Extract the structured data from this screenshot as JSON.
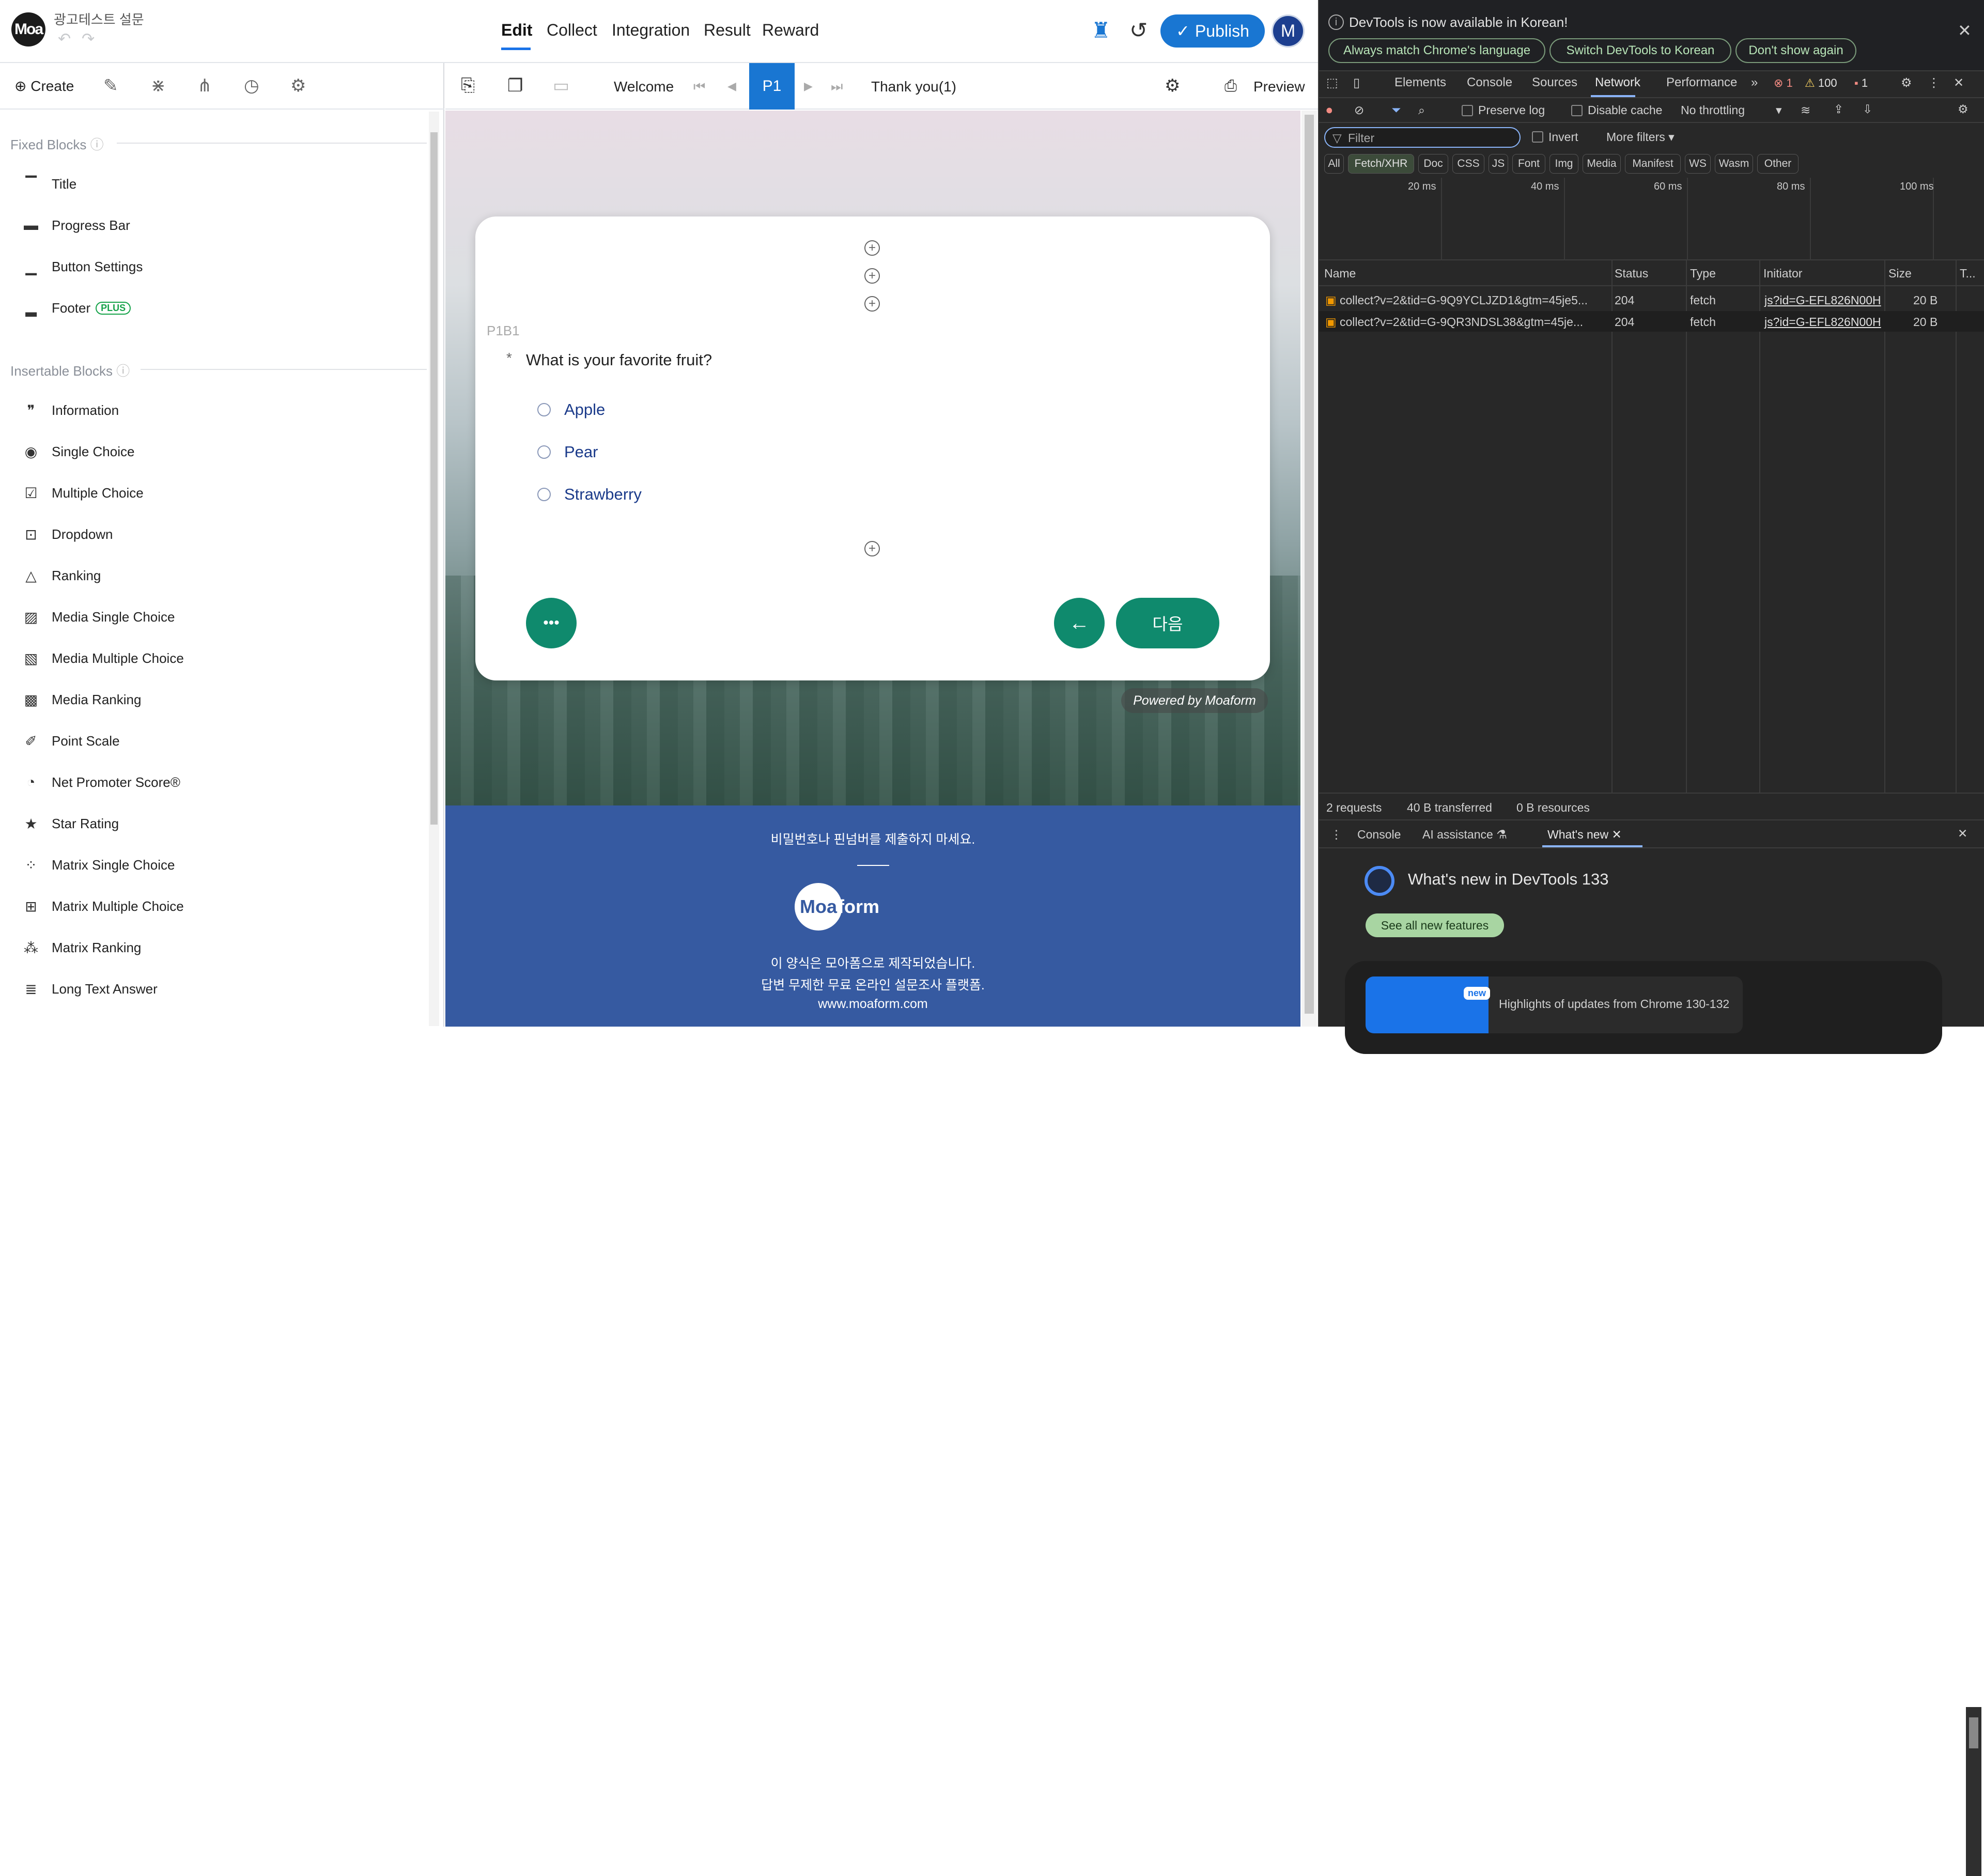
{
  "header": {
    "logo_text": "Moa",
    "form_title": "광고테스트 설문",
    "nav": [
      "Edit",
      "Collect",
      "Integration",
      "Result",
      "Reward"
    ],
    "publish_label": "Publish",
    "avatar_initial": "M"
  },
  "sidebar": {
    "create_label": "Create",
    "fixed_title": "Fixed Blocks",
    "fixed_blocks": [
      {
        "label": "Title",
        "icon": "title-block-icon"
      },
      {
        "label": "Progress Bar",
        "icon": "progress-bar-icon"
      },
      {
        "label": "Button Settings",
        "icon": "button-settings-icon"
      },
      {
        "label": "Footer",
        "icon": "footer-icon",
        "badge": "PLUS"
      }
    ],
    "insertable_title": "Insertable Blocks",
    "insertable_blocks": [
      {
        "label": "Information",
        "icon": "quote-icon"
      },
      {
        "label": "Single Choice",
        "icon": "radio-icon"
      },
      {
        "label": "Multiple Choice",
        "icon": "checkbox-icon"
      },
      {
        "label": "Dropdown",
        "icon": "dropdown-icon"
      },
      {
        "label": "Ranking",
        "icon": "triangle-icon"
      },
      {
        "label": "Media Single Choice",
        "icon": "media-radio-icon"
      },
      {
        "label": "Media Multiple Choice",
        "icon": "media-checkbox-icon"
      },
      {
        "label": "Media Ranking",
        "icon": "media-ranking-icon"
      },
      {
        "label": "Point Scale",
        "icon": "ruler-icon"
      },
      {
        "label": "Net Promoter Score®",
        "icon": "gauge-icon"
      },
      {
        "label": "Star Rating",
        "icon": "star-icon"
      },
      {
        "label": "Matrix Single Choice",
        "icon": "matrix-radio-icon"
      },
      {
        "label": "Matrix Multiple Choice",
        "icon": "matrix-checkbox-icon"
      },
      {
        "label": "Matrix Ranking",
        "icon": "matrix-ranking-icon"
      },
      {
        "label": "Long Text Answer",
        "icon": "long-text-icon"
      }
    ]
  },
  "editor": {
    "welcome_label": "Welcome",
    "page_label": "P1",
    "thankyou_label": "Thank you(1)",
    "preview_label": "Preview"
  },
  "survey": {
    "block_id": "P1B1",
    "required_mark": "*",
    "question": "What is your favorite fruit?",
    "options": [
      "Apple",
      "Pear",
      "Strawberry"
    ],
    "next_label": "다음",
    "powered_by": "Powered by Moaform",
    "footer_notice": "비밀번호나 핀넘버를 제출하지 마세요.",
    "footer_logo_a": "Moa",
    "footer_logo_b": "form",
    "footer_line1": "이 양식은 모아폼으로 제작되었습니다.",
    "footer_line2": "답변 무제한 무료 온라인 설문조사 플랫폼.",
    "footer_url": "www.moaform.com"
  },
  "devtools": {
    "info_text": "DevTools is now available in Korean!",
    "info_buttons": [
      "Always match Chrome's language",
      "Switch DevTools to Korean",
      "Don't show again"
    ],
    "tabs": [
      "Elements",
      "Console",
      "Sources",
      "Network",
      "Performance"
    ],
    "error_count": "1",
    "warning_count": "100",
    "issue_count": "1",
    "preserve_log": "Preserve log",
    "disable_cache": "Disable cache",
    "throttling": "No throttling",
    "filter_placeholder": "Filter",
    "invert": "Invert",
    "more_filters": "More filters",
    "type_filters": [
      "All",
      "Fetch/XHR",
      "Doc",
      "CSS",
      "JS",
      "Font",
      "Img",
      "Media",
      "Manifest",
      "WS",
      "Wasm",
      "Other"
    ],
    "timeline_labels": [
      "20 ms",
      "40 ms",
      "60 ms",
      "80 ms",
      "100 ms"
    ],
    "columns": [
      "Name",
      "Status",
      "Type",
      "Initiator",
      "Size",
      "T..."
    ],
    "requests": [
      {
        "name": "collect?v=2&tid=G-9Q9YCLJZD1&gtm=45je5...",
        "status": "204",
        "type": "fetch",
        "initiator": "js?id=G-EFL826N00H",
        "size": "20 B"
      },
      {
        "name": "collect?v=2&tid=G-9QR3NDSL38&gtm=45je...",
        "status": "204",
        "type": "fetch",
        "initiator": "js?id=G-EFL826N00H",
        "size": "20 B"
      }
    ],
    "summary": [
      "2 requests",
      "40 B transferred",
      "0 B resources"
    ],
    "drawer_tabs": [
      "Console",
      "AI assistance",
      "What's new"
    ],
    "whatsnew_title": "What's new in DevTools 133",
    "see_all": "See all new features",
    "highlight_tag": "new",
    "highlight_text": "Highlights of updates from Chrome 130-132"
  }
}
